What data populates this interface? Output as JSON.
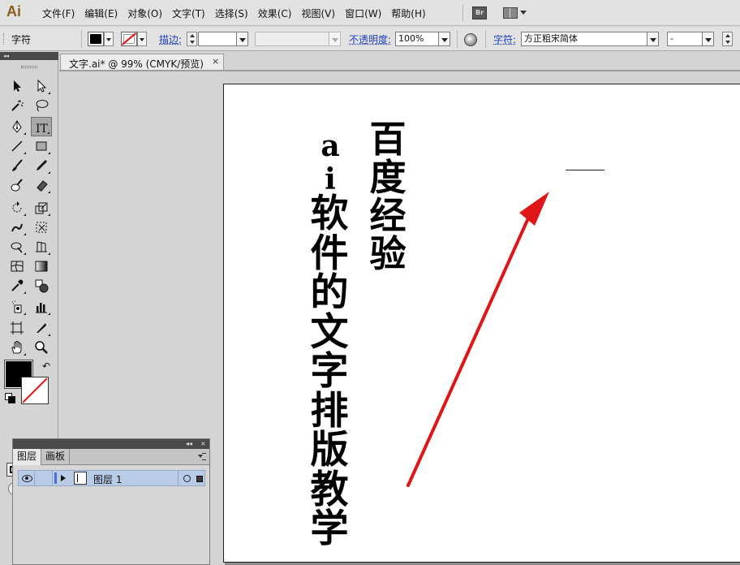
{
  "app": {
    "logo": "Ai"
  },
  "menu": {
    "items": [
      "文件(F)",
      "编辑(E)",
      "对象(O)",
      "文字(T)",
      "选择(S)",
      "效果(C)",
      "视图(V)",
      "窗口(W)",
      "帮助(H)"
    ],
    "bridge_label": "Br"
  },
  "control": {
    "mode_label": "字符",
    "stroke_label": "描边:",
    "opacity_label": "不透明度:",
    "opacity_value": "100%",
    "font_label": "字符:",
    "font_value": "方正粗宋简体",
    "font_style_value": "-"
  },
  "document": {
    "tab_title": "文字.ai* @ 99% (CMYK/预览)",
    "close_symbol": "×"
  },
  "artboard": {
    "text_column_1": "百度经验",
    "text_column_2": "ai",
    "text_column_3": "软件的文字排版教学"
  },
  "layers_panel": {
    "tabs": [
      "图层",
      "画板"
    ],
    "collapse_symbol": "◂◂",
    "close_symbol": "×",
    "layer_name": "图层 1"
  },
  "colors": {
    "annotation_arrow": "#e01515",
    "layer_highlight": "#b8cce8",
    "layer_color_tag": "#4c6ee0"
  }
}
